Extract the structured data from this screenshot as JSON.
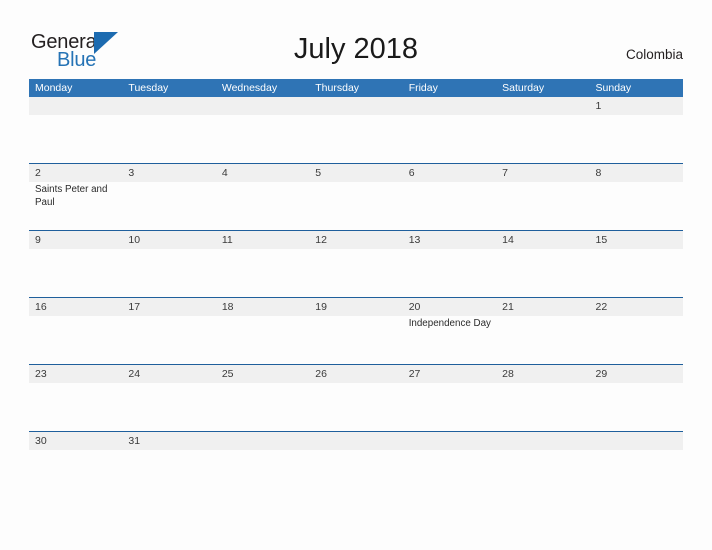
{
  "brand": {
    "word_one": "General",
    "word_two": "Blue",
    "triangle_icon": "triangle-icon",
    "color_dark": "#231f20",
    "color_blue": "#2573b5"
  },
  "header": {
    "title": "July 2018",
    "country": "Colombia"
  },
  "theme": {
    "header_blue": "#2f74b5",
    "separator_blue": "#1f5f9c",
    "date_band_gray": "#f0f0f0",
    "page_background": "#fdfdfd"
  },
  "calendar": {
    "month": "July",
    "year": "2018",
    "weekday_headers": [
      "Monday",
      "Tuesday",
      "Wednesday",
      "Thursday",
      "Friday",
      "Saturday",
      "Sunday"
    ],
    "weeks": [
      {
        "dates": [
          "",
          "",
          "",
          "",
          "",
          "",
          "1"
        ],
        "events": [
          "",
          "",
          "",
          "",
          "",
          "",
          ""
        ]
      },
      {
        "dates": [
          "2",
          "3",
          "4",
          "5",
          "6",
          "7",
          "8"
        ],
        "events": [
          "Saints Peter and Paul",
          "",
          "",
          "",
          "",
          "",
          ""
        ]
      },
      {
        "dates": [
          "9",
          "10",
          "11",
          "12",
          "13",
          "14",
          "15"
        ],
        "events": [
          "",
          "",
          "",
          "",
          "",
          "",
          ""
        ]
      },
      {
        "dates": [
          "16",
          "17",
          "18",
          "19",
          "20",
          "21",
          "22"
        ],
        "events": [
          "",
          "",
          "",
          "",
          "Independence Day",
          "",
          ""
        ]
      },
      {
        "dates": [
          "23",
          "24",
          "25",
          "26",
          "27",
          "28",
          "29"
        ],
        "events": [
          "",
          "",
          "",
          "",
          "",
          "",
          ""
        ]
      },
      {
        "dates": [
          "30",
          "31",
          "",
          "",
          "",
          "",
          ""
        ],
        "events": [
          "",
          "",
          "",
          "",
          "",
          "",
          ""
        ]
      }
    ]
  }
}
